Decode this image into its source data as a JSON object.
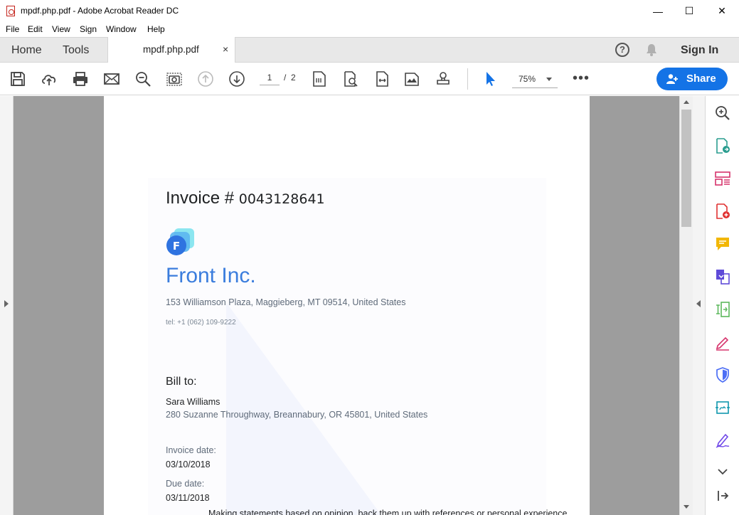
{
  "window": {
    "title": "mpdf.php.pdf - Adobe Acrobat Reader DC",
    "minimize": "—",
    "maximize": "☐",
    "close": "✕"
  },
  "menu": [
    "File",
    "Edit",
    "View",
    "Sign",
    "Window",
    "Help"
  ],
  "tabs": {
    "home": "Home",
    "tools": "Tools",
    "document": "mpdf.php.pdf",
    "close": "×"
  },
  "header": {
    "help": "?",
    "sign_in": "Sign In"
  },
  "toolbar": {
    "current_page": "1",
    "page_separator": "/",
    "total_pages": "2",
    "zoom": "75%",
    "more": "•••",
    "share_label": "Share"
  },
  "document": {
    "invoice_label": "Invoice # ",
    "invoice_number": "0043128641",
    "logo_letter": "F",
    "company_name": "Front Inc.",
    "company_address": "153 Williamson Plaza, Maggieberg, MT 09514, United States",
    "company_tel": "tel: +1 (062) 109-9222",
    "bill_to_label": "Bill to:",
    "client_name": "Sara Williams",
    "client_address": "280 Suzanne Throughway, Breannabury, OR 45801, United States",
    "invoice_date_label": "Invoice date:",
    "invoice_date": "03/10/2018",
    "due_date_label": "Due date:",
    "due_date": "03/11/2018",
    "cut_off_text": "Making statements based on opinion, back them up with references or personal experience"
  },
  "colors": {
    "accent": "#1473e6",
    "brand_blue": "#3b7ddd",
    "canvas_gray": "#9d9d9d"
  }
}
